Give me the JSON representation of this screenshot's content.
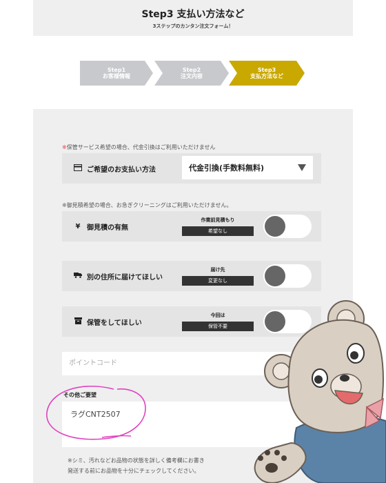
{
  "header": {
    "title": "Step3 支払い方法など",
    "subtitle": "3ステップのカンタン注文フォーム！"
  },
  "steps": [
    {
      "line1": "Step1",
      "line2": "お客様情報",
      "color": "#c8c9cd"
    },
    {
      "line1": "Step2",
      "line2": "注文内容",
      "color": "#c8c9cd"
    },
    {
      "line1": "Step3",
      "line2": "支払方法など",
      "color": "#c9a800"
    }
  ],
  "notes": {
    "storage_note_mark": "※",
    "storage_note": "保管サービス希望の場合、代金引換はご利用いただけません",
    "estimate_note": "※御見積希望の場合、お急ぎクリーニングはご利用いただけません。"
  },
  "payment": {
    "icon": "credit-card-icon",
    "label": "ご希望のお支払い方法",
    "selected": "代金引換(手数料無料)"
  },
  "estimate": {
    "icon": "yen-icon",
    "label": "御見積の有無",
    "caption": "作業前見積もり",
    "state": "希望なし"
  },
  "address": {
    "icon": "truck-icon",
    "label": "別の住所に届けてほしい",
    "caption": "届け先",
    "state": "変更なし"
  },
  "storage": {
    "icon": "storage-box-icon",
    "label": "保管をしてほしい",
    "caption": "今回は",
    "state": "保管不要"
  },
  "point_code": {
    "placeholder": "ポイントコード"
  },
  "other_requests": {
    "label": "その他ご要望",
    "value": "ラグCNT2507"
  },
  "bottom_note": {
    "line1": "※シミ、汚れなどお品物の状態を詳しく備考欄にお書き",
    "line2": "発送する前にお品物を十分にチェックしてください。"
  },
  "colors": {
    "accent": "#c9a800",
    "annotation": "#e040c0"
  }
}
